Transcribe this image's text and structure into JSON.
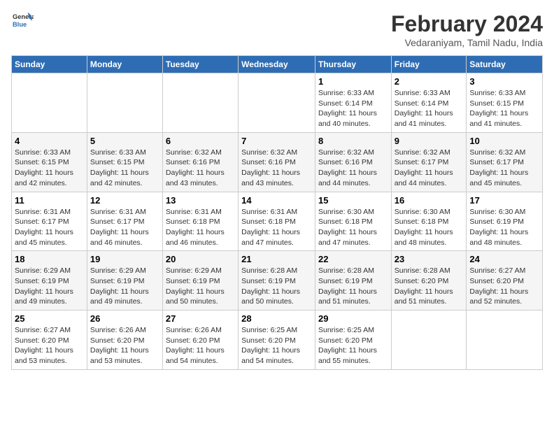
{
  "logo": {
    "line1": "General",
    "line2": "Blue"
  },
  "title": "February 2024",
  "subtitle": "Vedaraniyam, Tamil Nadu, India",
  "weekdays": [
    "Sunday",
    "Monday",
    "Tuesday",
    "Wednesday",
    "Thursday",
    "Friday",
    "Saturday"
  ],
  "weeks": [
    [
      {
        "day": "",
        "info": ""
      },
      {
        "day": "",
        "info": ""
      },
      {
        "day": "",
        "info": ""
      },
      {
        "day": "",
        "info": ""
      },
      {
        "day": "1",
        "info": "Sunrise: 6:33 AM\nSunset: 6:14 PM\nDaylight: 11 hours\nand 40 minutes."
      },
      {
        "day": "2",
        "info": "Sunrise: 6:33 AM\nSunset: 6:14 PM\nDaylight: 11 hours\nand 41 minutes."
      },
      {
        "day": "3",
        "info": "Sunrise: 6:33 AM\nSunset: 6:15 PM\nDaylight: 11 hours\nand 41 minutes."
      }
    ],
    [
      {
        "day": "4",
        "info": "Sunrise: 6:33 AM\nSunset: 6:15 PM\nDaylight: 11 hours\nand 42 minutes."
      },
      {
        "day": "5",
        "info": "Sunrise: 6:33 AM\nSunset: 6:15 PM\nDaylight: 11 hours\nand 42 minutes."
      },
      {
        "day": "6",
        "info": "Sunrise: 6:32 AM\nSunset: 6:16 PM\nDaylight: 11 hours\nand 43 minutes."
      },
      {
        "day": "7",
        "info": "Sunrise: 6:32 AM\nSunset: 6:16 PM\nDaylight: 11 hours\nand 43 minutes."
      },
      {
        "day": "8",
        "info": "Sunrise: 6:32 AM\nSunset: 6:16 PM\nDaylight: 11 hours\nand 44 minutes."
      },
      {
        "day": "9",
        "info": "Sunrise: 6:32 AM\nSunset: 6:17 PM\nDaylight: 11 hours\nand 44 minutes."
      },
      {
        "day": "10",
        "info": "Sunrise: 6:32 AM\nSunset: 6:17 PM\nDaylight: 11 hours\nand 45 minutes."
      }
    ],
    [
      {
        "day": "11",
        "info": "Sunrise: 6:31 AM\nSunset: 6:17 PM\nDaylight: 11 hours\nand 45 minutes."
      },
      {
        "day": "12",
        "info": "Sunrise: 6:31 AM\nSunset: 6:17 PM\nDaylight: 11 hours\nand 46 minutes."
      },
      {
        "day": "13",
        "info": "Sunrise: 6:31 AM\nSunset: 6:18 PM\nDaylight: 11 hours\nand 46 minutes."
      },
      {
        "day": "14",
        "info": "Sunrise: 6:31 AM\nSunset: 6:18 PM\nDaylight: 11 hours\nand 47 minutes."
      },
      {
        "day": "15",
        "info": "Sunrise: 6:30 AM\nSunset: 6:18 PM\nDaylight: 11 hours\nand 47 minutes."
      },
      {
        "day": "16",
        "info": "Sunrise: 6:30 AM\nSunset: 6:18 PM\nDaylight: 11 hours\nand 48 minutes."
      },
      {
        "day": "17",
        "info": "Sunrise: 6:30 AM\nSunset: 6:19 PM\nDaylight: 11 hours\nand 48 minutes."
      }
    ],
    [
      {
        "day": "18",
        "info": "Sunrise: 6:29 AM\nSunset: 6:19 PM\nDaylight: 11 hours\nand 49 minutes."
      },
      {
        "day": "19",
        "info": "Sunrise: 6:29 AM\nSunset: 6:19 PM\nDaylight: 11 hours\nand 49 minutes."
      },
      {
        "day": "20",
        "info": "Sunrise: 6:29 AM\nSunset: 6:19 PM\nDaylight: 11 hours\nand 50 minutes."
      },
      {
        "day": "21",
        "info": "Sunrise: 6:28 AM\nSunset: 6:19 PM\nDaylight: 11 hours\nand 50 minutes."
      },
      {
        "day": "22",
        "info": "Sunrise: 6:28 AM\nSunset: 6:19 PM\nDaylight: 11 hours\nand 51 minutes."
      },
      {
        "day": "23",
        "info": "Sunrise: 6:28 AM\nSunset: 6:20 PM\nDaylight: 11 hours\nand 51 minutes."
      },
      {
        "day": "24",
        "info": "Sunrise: 6:27 AM\nSunset: 6:20 PM\nDaylight: 11 hours\nand 52 minutes."
      }
    ],
    [
      {
        "day": "25",
        "info": "Sunrise: 6:27 AM\nSunset: 6:20 PM\nDaylight: 11 hours\nand 53 minutes."
      },
      {
        "day": "26",
        "info": "Sunrise: 6:26 AM\nSunset: 6:20 PM\nDaylight: 11 hours\nand 53 minutes."
      },
      {
        "day": "27",
        "info": "Sunrise: 6:26 AM\nSunset: 6:20 PM\nDaylight: 11 hours\nand 54 minutes."
      },
      {
        "day": "28",
        "info": "Sunrise: 6:25 AM\nSunset: 6:20 PM\nDaylight: 11 hours\nand 54 minutes."
      },
      {
        "day": "29",
        "info": "Sunrise: 6:25 AM\nSunset: 6:20 PM\nDaylight: 11 hours\nand 55 minutes."
      },
      {
        "day": "",
        "info": ""
      },
      {
        "day": "",
        "info": ""
      }
    ]
  ]
}
